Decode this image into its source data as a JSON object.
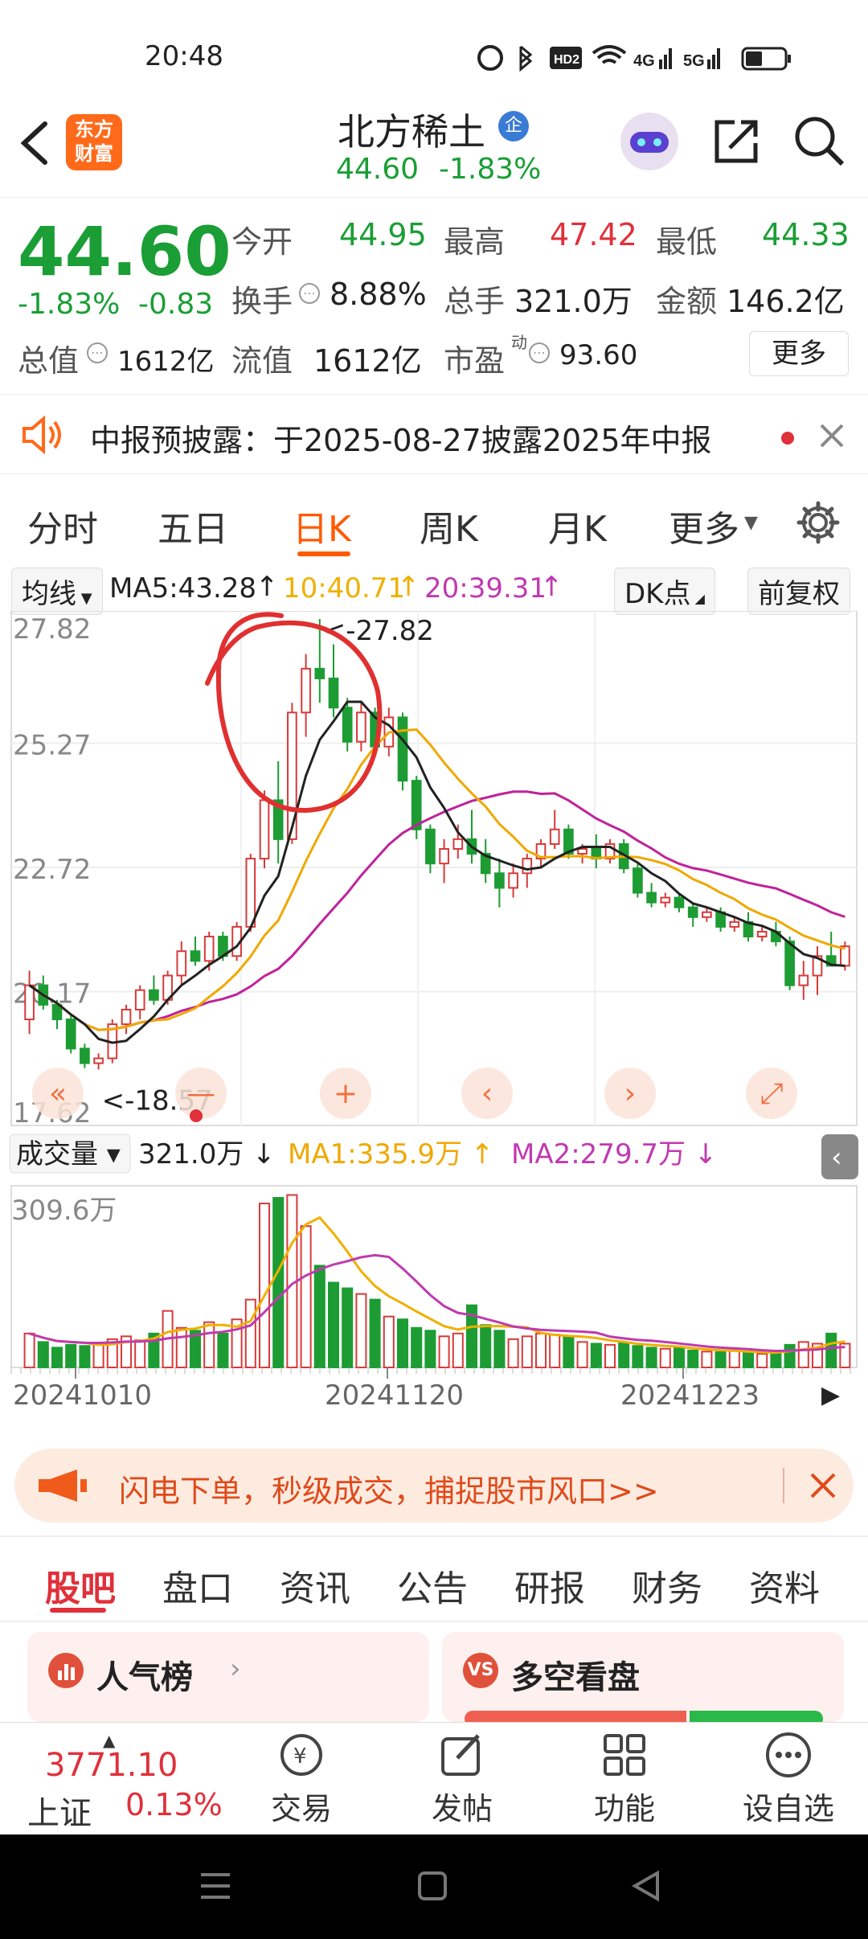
{
  "status_bar": {
    "time": "20:48",
    "network": "4G 5G",
    "hd": "HD2"
  },
  "header": {
    "title": "北方稀土",
    "badge": "企",
    "price": "44.60",
    "change_pct": "-1.83%",
    "logo_line1": "东方",
    "logo_line2": "财富"
  },
  "quote": {
    "price": "44.60",
    "change_pct": "-1.83%",
    "change": "-0.83",
    "open_label": "今开",
    "open": "44.95",
    "high_label": "最高",
    "high": "47.42",
    "low_label": "最低",
    "low": "44.33",
    "turnover_label": "换手",
    "turnover": "8.88%",
    "volume_label": "总手",
    "volume": "321.0万",
    "amount_label": "金额",
    "amount": "146.2亿",
    "mktcap_label": "总值",
    "mktcap": "1612亿",
    "float_label": "流值",
    "float": "1612亿",
    "pe_label": "市盈",
    "pe_sup": "动",
    "pe": "93.60",
    "more": "更多"
  },
  "notice": {
    "text": "中报预披露：于2025-08-27披露2025年中报"
  },
  "tabs": [
    {
      "label": "分时"
    },
    {
      "label": "五日"
    },
    {
      "label": "日K"
    },
    {
      "label": "周K"
    },
    {
      "label": "月K"
    },
    {
      "label": "更多"
    }
  ],
  "chart_toolbar": {
    "indicator": "均线",
    "ma5": "MA5:43.28",
    "ma10": "10:40.71",
    "ma20": "20:39.31",
    "dk": "DK点",
    "adjust": "前复权"
  },
  "chart_data": {
    "type": "candlestick",
    "y_ticks": [
      "27.82",
      "25.27",
      "22.72",
      "20.17",
      "17.62"
    ],
    "ylim": [
      17.62,
      27.82
    ],
    "annotations": {
      "high": "<-27.82",
      "low": "<-18.57"
    },
    "x_ticks": [
      "20241010",
      "20241120",
      "20241223"
    ],
    "candles": [
      [
        19.6,
        20.6,
        19.3,
        20.3
      ],
      [
        20.3,
        20.5,
        19.8,
        19.9
      ],
      [
        19.9,
        20.0,
        19.4,
        19.6
      ],
      [
        19.6,
        19.7,
        18.9,
        19.0
      ],
      [
        19.0,
        19.1,
        18.6,
        18.7
      ],
      [
        18.7,
        18.9,
        18.57,
        18.8
      ],
      [
        18.8,
        19.6,
        18.7,
        19.5
      ],
      [
        19.5,
        19.9,
        19.3,
        19.8
      ],
      [
        19.8,
        20.3,
        19.6,
        20.2
      ],
      [
        20.2,
        20.5,
        19.9,
        20.0
      ],
      [
        20.0,
        20.6,
        19.9,
        20.5
      ],
      [
        20.5,
        21.2,
        20.3,
        21.0
      ],
      [
        21.0,
        21.3,
        20.7,
        20.8
      ],
      [
        20.8,
        21.4,
        20.6,
        21.3
      ],
      [
        21.3,
        21.4,
        20.8,
        20.9
      ],
      [
        20.9,
        21.6,
        20.8,
        21.5
      ],
      [
        21.5,
        23.0,
        21.4,
        22.9
      ],
      [
        22.9,
        24.3,
        22.7,
        24.1
      ],
      [
        24.1,
        24.9,
        22.8,
        23.3
      ],
      [
        23.3,
        26.1,
        23.2,
        25.9
      ],
      [
        25.9,
        27.1,
        25.4,
        26.8
      ],
      [
        26.8,
        27.82,
        26.1,
        26.6
      ],
      [
        26.6,
        27.3,
        25.8,
        26.0
      ],
      [
        26.0,
        26.2,
        25.1,
        25.3
      ],
      [
        25.3,
        26.1,
        25.1,
        25.9
      ],
      [
        25.9,
        26.0,
        25.0,
        25.2
      ],
      [
        25.2,
        26.0,
        25.0,
        25.8
      ],
      [
        25.8,
        25.9,
        24.3,
        24.5
      ],
      [
        24.5,
        24.6,
        23.3,
        23.5
      ],
      [
        23.5,
        23.6,
        22.6,
        22.8
      ],
      [
        22.8,
        23.3,
        22.4,
        23.1
      ],
      [
        23.1,
        23.6,
        22.9,
        23.3
      ],
      [
        23.3,
        23.9,
        22.8,
        23.0
      ],
      [
        23.0,
        23.3,
        22.4,
        22.6
      ],
      [
        22.6,
        22.9,
        21.9,
        22.3
      ],
      [
        22.3,
        22.8,
        22.1,
        22.6
      ],
      [
        22.6,
        23.0,
        22.3,
        22.9
      ],
      [
        22.9,
        23.3,
        22.7,
        23.2
      ],
      [
        23.2,
        23.9,
        23.1,
        23.5
      ],
      [
        23.5,
        23.6,
        22.9,
        23.0
      ],
      [
        23.0,
        23.2,
        22.8,
        23.1
      ],
      [
        23.1,
        23.4,
        22.7,
        22.9
      ],
      [
        22.9,
        23.3,
        22.8,
        23.2
      ],
      [
        23.2,
        23.3,
        22.6,
        22.7
      ],
      [
        22.7,
        22.8,
        22.1,
        22.2
      ],
      [
        22.2,
        22.4,
        21.9,
        22.0
      ],
      [
        22.0,
        22.2,
        21.9,
        22.1
      ],
      [
        22.1,
        22.2,
        21.8,
        21.9
      ],
      [
        21.9,
        22.0,
        21.5,
        21.7
      ],
      [
        21.7,
        21.9,
        21.6,
        21.8
      ],
      [
        21.8,
        21.9,
        21.4,
        21.5
      ],
      [
        21.5,
        21.7,
        21.4,
        21.6
      ],
      [
        21.6,
        21.8,
        21.2,
        21.3
      ],
      [
        21.3,
        21.5,
        21.2,
        21.4
      ],
      [
        21.4,
        21.6,
        21.1,
        21.2
      ],
      [
        21.2,
        21.3,
        20.2,
        20.3
      ],
      [
        20.3,
        20.8,
        20.0,
        20.5
      ],
      [
        20.5,
        21.1,
        20.1,
        20.9
      ],
      [
        20.9,
        21.4,
        20.7,
        20.7
      ],
      [
        20.7,
        21.2,
        20.6,
        21.1
      ]
    ],
    "volume": {
      "label": "成交量",
      "value": "321.0万",
      "ma1": "MA1:335.9万",
      "ma2": "MA2:279.7万",
      "max_label": "309.6万",
      "bars": [
        60,
        45,
        35,
        40,
        38,
        42,
        50,
        55,
        48,
        60,
        100,
        70,
        65,
        80,
        60,
        85,
        120,
        290,
        300,
        305,
        250,
        180,
        150,
        140,
        130,
        120,
        90,
        85,
        70,
        65,
        55,
        60,
        110,
        75,
        65,
        50,
        55,
        60,
        58,
        55,
        45,
        42,
        40,
        44,
        38,
        35,
        33,
        34,
        30,
        28,
        27,
        29,
        26,
        24,
        25,
        40,
        45,
        42,
        60,
        42
      ]
    }
  },
  "promo": {
    "text": "闪电下单，秒级成交，捕捉股市风口>>"
  },
  "section_tabs": [
    {
      "label": "股吧"
    },
    {
      "label": "盘口"
    },
    {
      "label": "资讯"
    },
    {
      "label": "公告"
    },
    {
      "label": "研报"
    },
    {
      "label": "财务"
    },
    {
      "label": "资料"
    }
  ],
  "cards": {
    "popularity": "人气榜",
    "bull_bear": "多空看盘"
  },
  "bottom_nav": {
    "index_value": "3771.10",
    "index_name": "上证",
    "index_change": "0.13%",
    "items": [
      {
        "label": "交易"
      },
      {
        "label": "发帖"
      },
      {
        "label": "功能"
      },
      {
        "label": "设自选"
      }
    ]
  }
}
